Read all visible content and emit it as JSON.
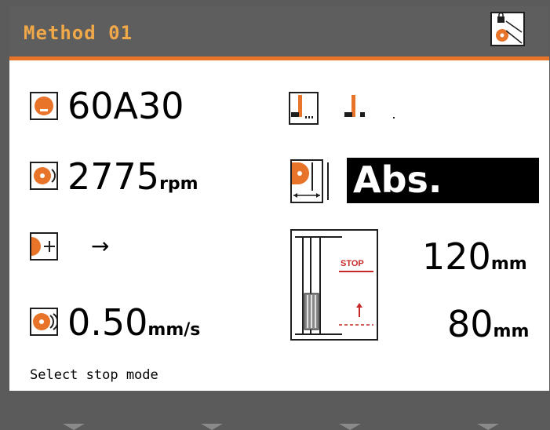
{
  "header": {
    "title": "Method 01",
    "lock_icon": "lock-wheel-icon"
  },
  "left": {
    "wheel": {
      "icon": "wheel-icon",
      "value": "60A30"
    },
    "speed": {
      "icon": "spinning-wheel-icon",
      "value": "2775",
      "unit": "rpm"
    },
    "direction": {
      "icon": "wheel-move-icon",
      "arrow": "→"
    },
    "feed": {
      "icon": "feed-wheel-icon",
      "value": "0.50",
      "unit": "mm/s"
    }
  },
  "right": {
    "dressing_icon": "dressing-icon",
    "mode": {
      "icon": "wheel-measure-icon",
      "value": "Abs."
    },
    "stop": {
      "icon": "stop-mode-icon",
      "stop_label": "STOP",
      "upper_value": "120",
      "upper_unit": "mm",
      "lower_value": "80",
      "lower_unit": "mm"
    }
  },
  "status": "Select stop mode",
  "colors": {
    "accent": "#e8742a",
    "title": "#f0a848",
    "header": "#5e5e5e"
  }
}
